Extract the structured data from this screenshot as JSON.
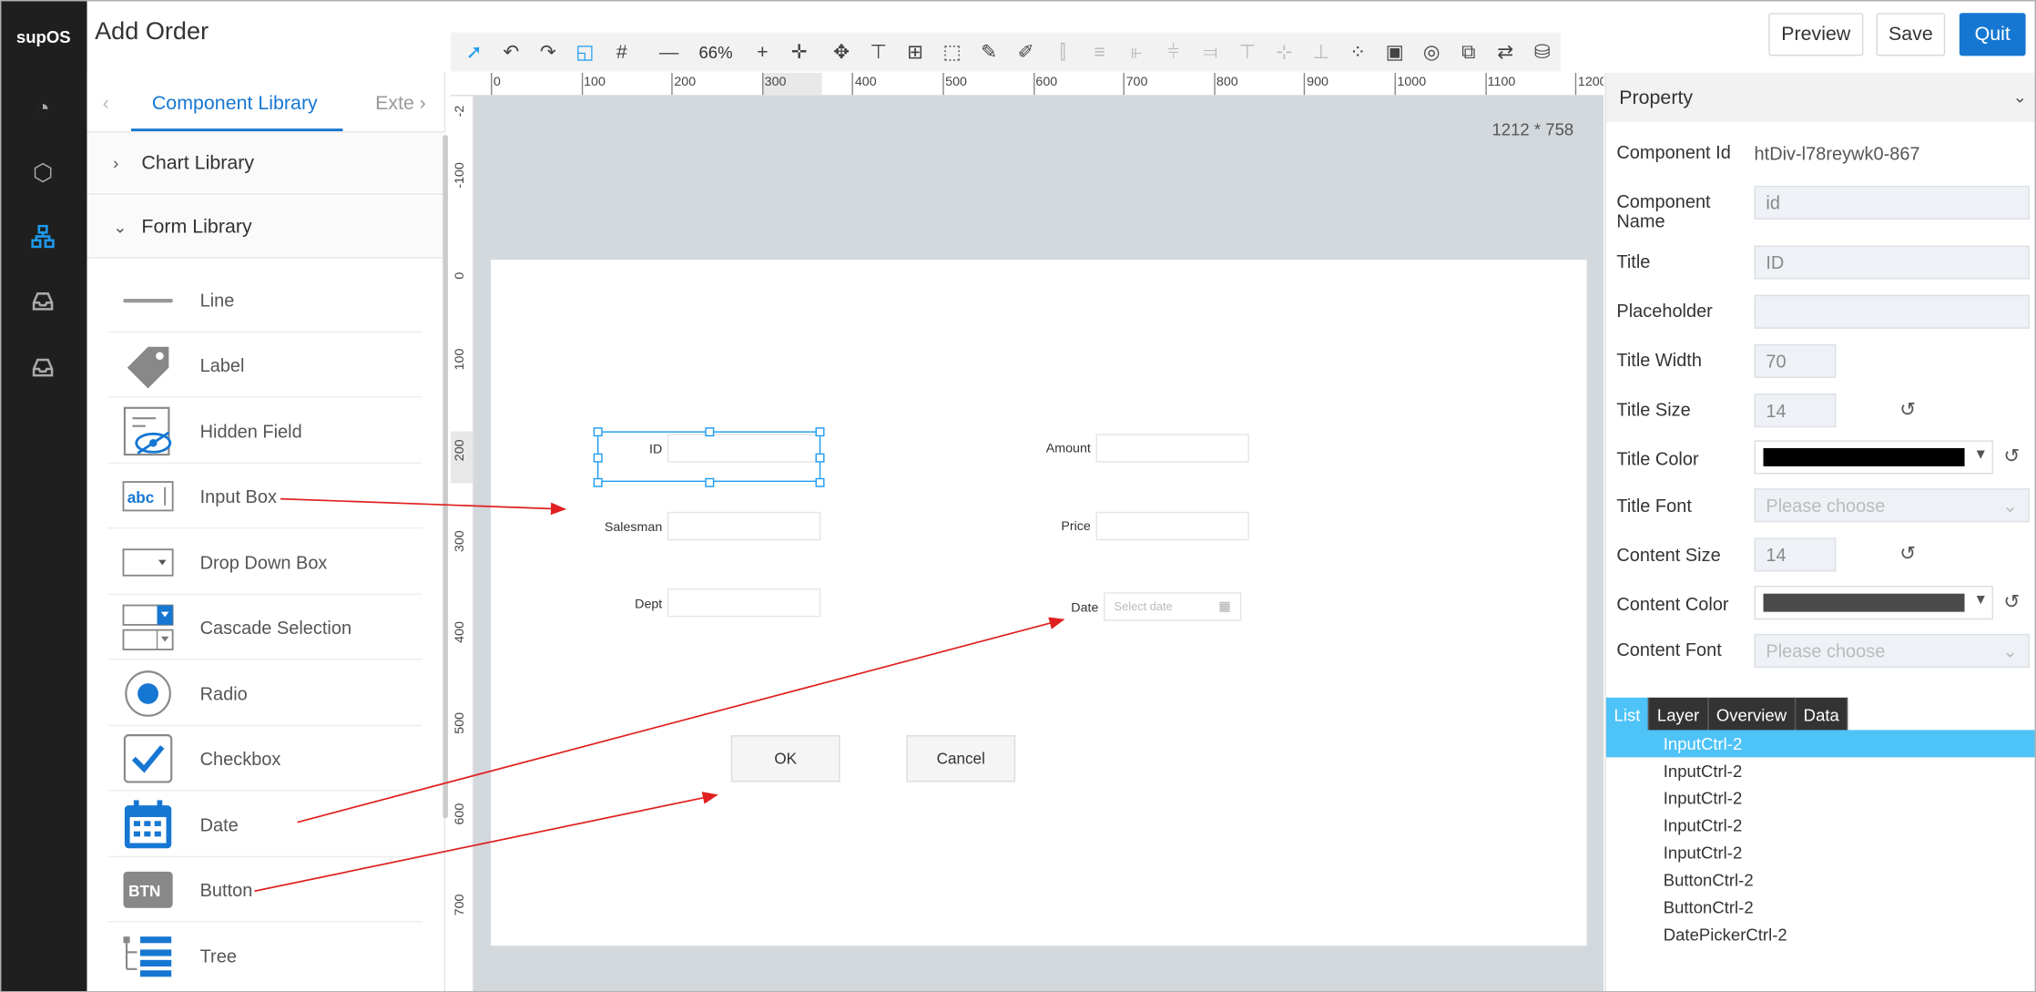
{
  "app": {
    "logo_text": "supOS",
    "title": "Add Order"
  },
  "nav_icons": [
    "dashboard-icon",
    "cube-icon",
    "org-chart-icon",
    "inbox-icon",
    "inbox-icon"
  ],
  "header": {
    "preview_label": "Preview",
    "save_label": "Save",
    "quit_label": "Quit"
  },
  "toolbar": {
    "zoom": "66%"
  },
  "left_panel": {
    "tabs": [
      "Component Library",
      "Exte"
    ],
    "chart_library": "Chart Library",
    "form_library": "Form Library",
    "items": [
      "Line",
      "Label",
      "Hidden Field",
      "Input Box",
      "Drop Down Box",
      "Cascade Selection",
      "Radio",
      "Checkbox",
      "Date",
      "Button",
      "Tree"
    ]
  },
  "rulers": {
    "h": [
      "0",
      "100",
      "200",
      "300",
      "400",
      "500",
      "600",
      "700",
      "800",
      "900",
      "1000",
      "1100",
      "1200"
    ],
    "v": [
      "-2",
      "-100",
      "0",
      "100",
      "200",
      "300",
      "400",
      "500",
      "600",
      "700",
      "0"
    ]
  },
  "canvas": {
    "size_label": "1212 * 758",
    "fields": {
      "id": "ID",
      "salesman": "Salesman",
      "dept": "Dept",
      "amount": "Amount",
      "price": "Price",
      "date": "Date",
      "date_placeholder": "Select date"
    },
    "ok_label": "OK",
    "cancel_label": "Cancel"
  },
  "property": {
    "header": "Property",
    "component_id_label": "Component Id",
    "component_id_value": "htDiv-l78reywk0-867",
    "component_name_label": "Component Name",
    "component_name_value": "id",
    "title_label": "Title",
    "title_value": "ID",
    "placeholder_label": "Placeholder",
    "placeholder_value": "",
    "title_width_label": "Title Width",
    "title_width_value": "70",
    "title_size_label": "Title Size",
    "title_size_value": "14",
    "title_color_label": "Title Color",
    "title_color_value": "#000000",
    "title_font_label": "Title Font",
    "title_font_placeholder": "Please choose",
    "content_size_label": "Content Size",
    "content_size_value": "14",
    "content_color_label": "Content Color",
    "content_color_value": "#4a4a4a",
    "content_font_label": "Content Font",
    "content_font_placeholder": "Please choose"
  },
  "list_panel": {
    "tabs": [
      "List",
      "Layer",
      "Overview",
      "Data"
    ],
    "items": [
      "InputCtrl-2",
      "InputCtrl-2",
      "InputCtrl-2",
      "InputCtrl-2",
      "InputCtrl-2",
      "ButtonCtrl-2",
      "ButtonCtrl-2",
      "DatePickerCtrl-2"
    ]
  },
  "colors": {
    "accent": "#1677d2",
    "annotation_arrow": "#e02020",
    "selection": "#1e9bf0"
  }
}
